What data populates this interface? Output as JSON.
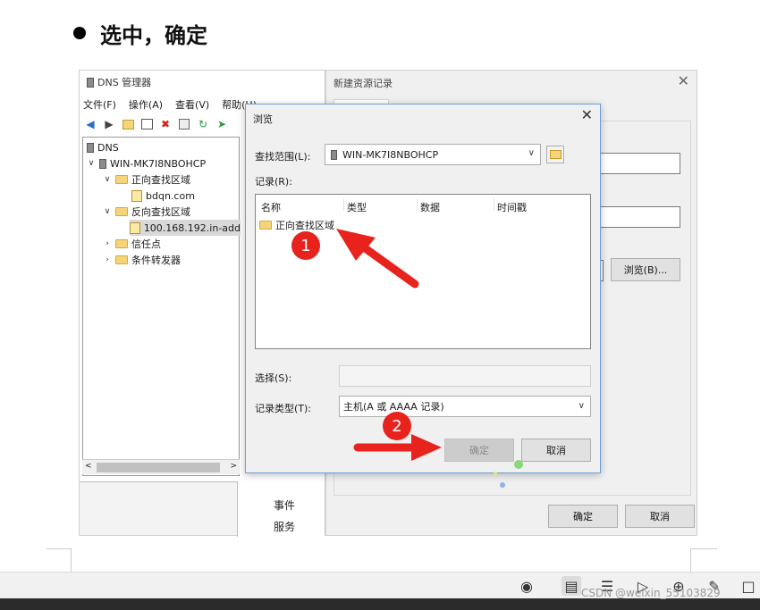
{
  "heading": {
    "text": "选中，确定"
  },
  "dns_manager": {
    "title": "DNS 管理器",
    "menu": [
      "文件(F)",
      "操作(A)",
      "查看(V)",
      "帮助(H)"
    ],
    "toolbar_icons": [
      "back-arrow-icon",
      "forward-arrow-icon",
      "folder-up-icon",
      "view-icon",
      "delete-icon",
      "properties-icon",
      "refresh-icon",
      "export-icon"
    ],
    "tree": {
      "root": "DNS",
      "server": "WIN-MK7I8NBOHCP",
      "forward_zones": "正向查找区域",
      "forward_child": "bdqn.com",
      "reverse_zones": "反向查找区域",
      "reverse_child": "100.168.192.in-add",
      "trust_points": "信任点",
      "conditional_forwarders": "条件转发器"
    },
    "events": [
      "事件",
      "服务"
    ]
  },
  "new_record": {
    "title": "新建资源记录",
    "browse_label": "浏览(B)...",
    "ok_label": "确定",
    "cancel_label": "取消"
  },
  "browse_dialog": {
    "title": "浏览",
    "scope_label": "查找范围(L):",
    "scope_value": "WIN-MK7I8NBOHCP",
    "records_label": "记录(R):",
    "columns": [
      "名称",
      "类型",
      "数据",
      "时间戳"
    ],
    "record_items": [
      "正向查找区域"
    ],
    "selection_label": "选择(S):",
    "selection_value": "",
    "record_type_label": "记录类型(T):",
    "record_type_value": "主机(A 或 AAAA 记录)",
    "ok_label": "确定",
    "cancel_label": "取消"
  },
  "annotations": {
    "step1": "1",
    "step2": "2",
    "accent_color": "#e8221c"
  },
  "watermark": "CSDN @weixin_55103829"
}
